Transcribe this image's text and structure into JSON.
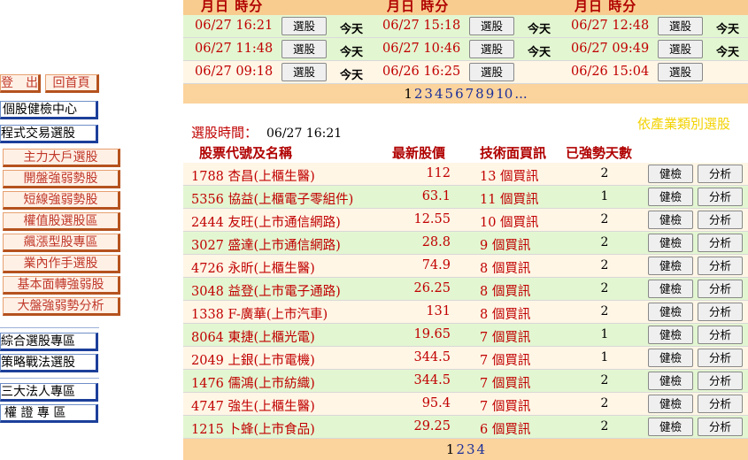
{
  "nav": {
    "logout": "登　出",
    "home": "回首頁",
    "items": [
      {
        "label": "個股健檢中心",
        "style": "blue"
      },
      {
        "label": "程式交易選股",
        "style": "blue"
      },
      {
        "label": "主力大戶選股",
        "style": "orange"
      },
      {
        "label": "開盤強弱勢股",
        "style": "orange"
      },
      {
        "label": "短線強弱勢股",
        "style": "orange"
      },
      {
        "label": "權值股選股區",
        "style": "orange"
      },
      {
        "label": "飆漲型股專區",
        "style": "orange"
      },
      {
        "label": "業內作手選股",
        "style": "orange"
      },
      {
        "label": "基本面轉強弱股",
        "style": "orange"
      },
      {
        "label": "大盤強弱勢分析",
        "style": "orange"
      },
      {
        "label": "綜合選股專區",
        "style": "blue"
      },
      {
        "label": "策略戰法選股",
        "style": "blue"
      },
      {
        "label": "三大法人專區",
        "style": "blue"
      },
      {
        "label": "權 證 專 區",
        "style": "blue"
      }
    ]
  },
  "history": {
    "header_label": "月日 時分",
    "select_label": "選股",
    "today_label": "今天",
    "rows": [
      [
        {
          "time": "06/27 16:21",
          "today": true
        },
        {
          "time": "06/27 15:18",
          "today": true
        },
        {
          "time": "06/27 12:48",
          "today": true
        }
      ],
      [
        {
          "time": "06/27 11:48",
          "today": true
        },
        {
          "time": "06/27 10:46",
          "today": true
        },
        {
          "time": "06/27 09:49",
          "today": true
        }
      ],
      [
        {
          "time": "06/27 09:18",
          "today": true
        },
        {
          "time": "06/26 16:25",
          "today": false
        },
        {
          "time": "06/26 15:04",
          "today": false
        }
      ]
    ],
    "pages": [
      "1",
      "2",
      "3",
      "4",
      "5",
      "6",
      "7",
      "8",
      "9",
      "10",
      "..."
    ]
  },
  "selection": {
    "time_label": "選股時間：",
    "time_value": "06/27 16:21",
    "industry_link": "依產業類別選股"
  },
  "list": {
    "headers": {
      "name": "股票代號及名稱",
      "price": "最新股價",
      "signal": "技術面買訊",
      "days": "已強勢天數"
    },
    "checkup_label": "健檢",
    "analysis_label": "分析",
    "rows": [
      {
        "name": "1788 杏昌(上櫃生醫)",
        "price": "112",
        "signal": "13 個買訊",
        "days": "2"
      },
      {
        "name": "5356 協益(上櫃電子零組件)",
        "price": "63.1",
        "signal": "11 個買訊",
        "days": "1"
      },
      {
        "name": "2444 友旺(上市通信網路)",
        "price": "12.55",
        "signal": "10 個買訊",
        "days": "2"
      },
      {
        "name": "3027 盛達(上市通信網路)",
        "price": "28.8",
        "signal": "9 個買訊",
        "days": "2"
      },
      {
        "name": "4726 永昕(上櫃生醫)",
        "price": "74.9",
        "signal": "8 個買訊",
        "days": "2"
      },
      {
        "name": "3048 益登(上市電子通路)",
        "price": "26.25",
        "signal": "8 個買訊",
        "days": "2"
      },
      {
        "name": "1338 F-廣華(上市汽車)",
        "price": "131",
        "signal": "8 個買訊",
        "days": "2"
      },
      {
        "name": "8064 東捷(上櫃光電)",
        "price": "19.65",
        "signal": "7 個買訊",
        "days": "1"
      },
      {
        "name": "2049 上銀(上市電機)",
        "price": "344.5",
        "signal": "7 個買訊",
        "days": "1"
      },
      {
        "name": "1476 儒鴻(上市紡織)",
        "price": "344.5",
        "signal": "7 個買訊",
        "days": "2"
      },
      {
        "name": "4747 強生(上櫃生醫)",
        "price": "95.4",
        "signal": "7 個買訊",
        "days": "2"
      },
      {
        "name": "1215 卜蜂(上市食品)",
        "price": "29.25",
        "signal": "6 個買訊",
        "days": "2"
      }
    ],
    "pages": [
      "1",
      "2",
      "3",
      "4"
    ]
  },
  "colors": {
    "accent": "#c00000",
    "header_bg": "#f8cc8e",
    "row_green": "#e3f6d2",
    "row_cream": "#fff6e6",
    "link_blue": "#1a2f9a"
  }
}
